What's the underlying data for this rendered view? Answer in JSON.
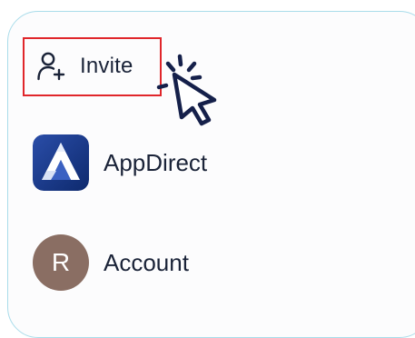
{
  "menu": {
    "invite": {
      "label": "Invite",
      "icon": "add-user-icon"
    },
    "appdirect": {
      "label": "AppDirect",
      "icon": "appdirect-logo-icon"
    },
    "account": {
      "label": "Account",
      "avatar_initial": "R",
      "avatar_color": "#8a6e63"
    }
  },
  "colors": {
    "panel_border": "#a9dcea",
    "highlight": "#e0262b",
    "text": "#1a2338",
    "cursor": "#15204a"
  },
  "cursor": {
    "icon": "click-pointer-icon"
  }
}
